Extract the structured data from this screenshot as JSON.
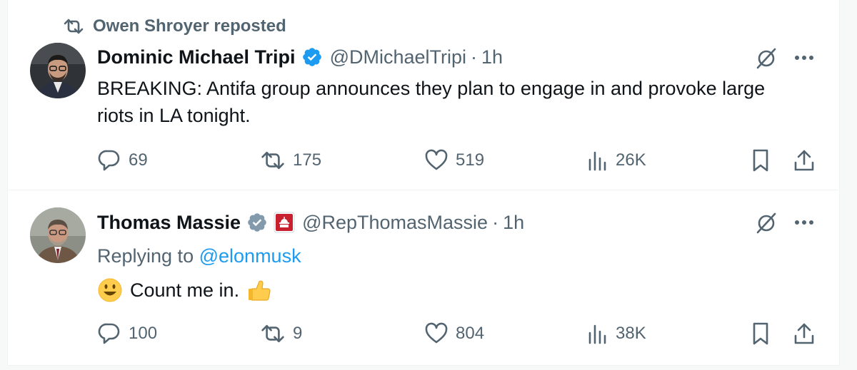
{
  "repost": {
    "label": "Owen Shroyer reposted"
  },
  "tweets": [
    {
      "name": "Dominic Michael Tripi",
      "handle": "@DMichaelTripi",
      "time": "1h",
      "text": "BREAKING: Antifa group announces they plan to engage in and provoke large riots in LA tonight.",
      "verified_color": "#1d9bf0",
      "stats": {
        "replies": "69",
        "reposts": "175",
        "likes": "519",
        "views": "26K"
      }
    },
    {
      "name": "Thomas Massie",
      "handle": "@RepThomasMassie",
      "time": "1h",
      "replying_prefix": "Replying to",
      "replying_to": "@elonmusk",
      "text": "Count me in.",
      "emoji_left": "smiley-face-emoji",
      "emoji_right": "thumbs-up-emoji",
      "verified_color": "#829aab",
      "affiliate": "us-capitol-icon",
      "stats": {
        "replies": "100",
        "reposts": "9",
        "likes": "804",
        "views": "38K"
      }
    }
  ],
  "colors": {
    "muted": "#536471",
    "accent": "#1d9bf0",
    "text": "#0f1419"
  }
}
